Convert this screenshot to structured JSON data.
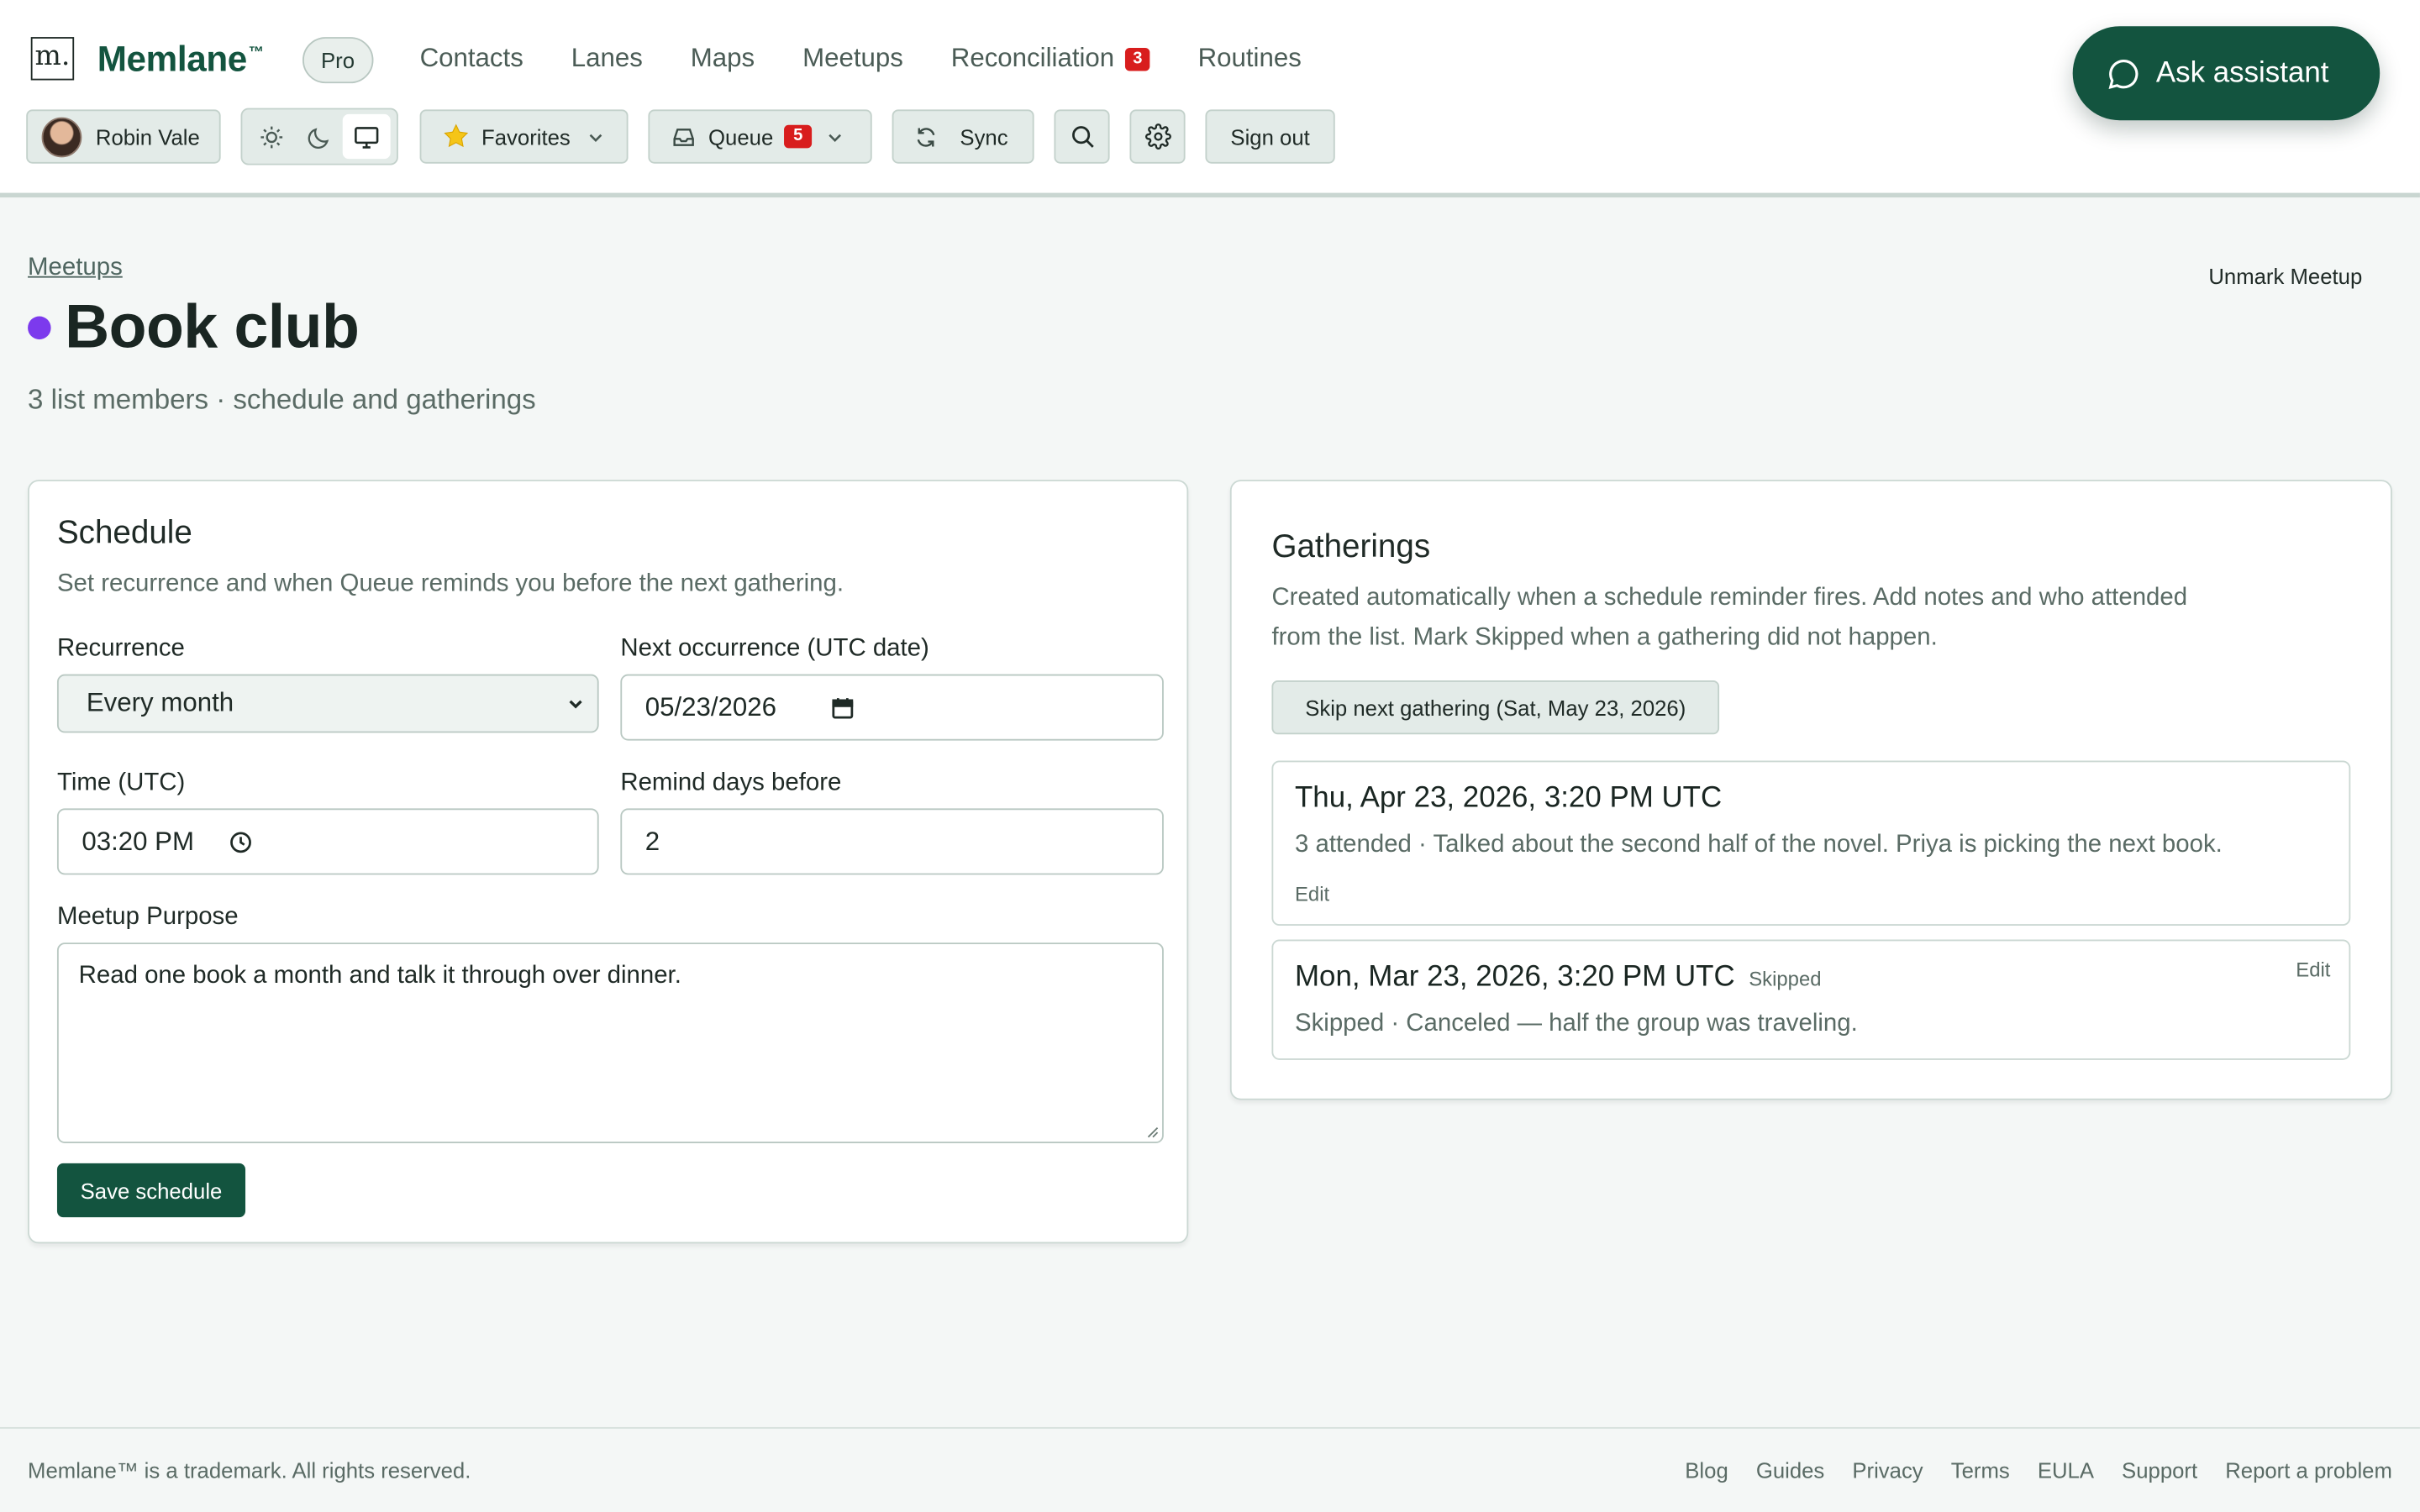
{
  "app": {
    "logo_letter": "m.",
    "name": "Memlane",
    "trademark": "™",
    "plan_badge": "Pro"
  },
  "nav": [
    {
      "label": "Contacts"
    },
    {
      "label": "Lanes"
    },
    {
      "label": "Maps"
    },
    {
      "label": "Meetups"
    },
    {
      "label": "Reconciliation",
      "badge": "3"
    },
    {
      "label": "Routines"
    }
  ],
  "toolbar": {
    "user_name": "Robin Vale",
    "theme_options": [
      "light-theme-icon",
      "dark-theme-icon",
      "system-theme-icon"
    ],
    "theme_selected": "system",
    "favorites_label": "Favorites",
    "queue_label": "Queue",
    "queue_count": "5",
    "sync_label": "Sync",
    "sign_out_label": "Sign out"
  },
  "ask_assistant_label": "Ask assistant",
  "page": {
    "breadcrumb": "Meetups",
    "unmark_label": "Unmark Meetup",
    "title": "Book club",
    "dot_color": "#7c3aed",
    "subtitle": "3 list members · schedule and gatherings"
  },
  "schedule": {
    "heading": "Schedule",
    "description": "Set recurrence and when Queue reminds you before the next gathering.",
    "recurrence_label": "Recurrence",
    "recurrence_value": "Every month",
    "next_label": "Next occurrence (UTC date)",
    "next_value": "05/23/2026",
    "time_label": "Time (UTC)",
    "time_value": "03:20 PM",
    "remind_label": "Remind days before",
    "remind_value": "2",
    "purpose_label": "Meetup Purpose",
    "purpose_value": "Read one book a month and talk it through over dinner.",
    "save_label": "Save schedule"
  },
  "gatherings": {
    "heading": "Gatherings",
    "description_line1": "Created automatically when a schedule reminder fires. Add notes and who attended",
    "description_line2": "from the list. Mark Skipped when a gathering did not happen.",
    "skip_label": "Skip next gathering (Sat, May 23, 2026)",
    "items": [
      {
        "title": "Thu, Apr 23, 2026, 3:20 PM UTC",
        "body": "3 attended · Talked about the second half of the novel. Priya is picking the next book.",
        "edit": "Edit"
      },
      {
        "title": "Mon, Mar 23, 2026, 3:20 PM UTC",
        "tag": "Skipped",
        "body": "Skipped · Canceled — half the group was traveling.",
        "edit": "Edit"
      }
    ]
  },
  "footer": {
    "text": "Memlane™ is a trademark. All rights reserved.",
    "links": [
      "Blog",
      "Guides",
      "Privacy",
      "Terms",
      "EULA",
      "Support",
      "Report a problem"
    ]
  },
  "colors": {
    "brand": "#13543f",
    "badge_red": "#d81d1d",
    "accent_dot": "#7c3aed"
  }
}
